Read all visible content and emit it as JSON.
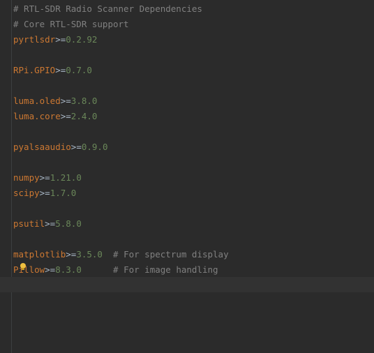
{
  "editor": {
    "lines": [
      {
        "comment": "# RTL-SDR Radio Scanner Dependencies"
      },
      {
        "comment": "# Core RTL-SDR support"
      },
      {
        "pkg": "pyrtlsdr",
        "op": ">=",
        "ver": "0.2.92"
      },
      {},
      {
        "pkg": "RPi.GPIO",
        "op": ">=",
        "ver": "0.7.0"
      },
      {},
      {
        "pkg": "luma.oled",
        "op": ">=",
        "ver": "3.8.0"
      },
      {
        "pkg": "luma.core",
        "op": ">=",
        "ver": "2.4.0"
      },
      {},
      {
        "pkg": "pyalsaaudio",
        "op": ">=",
        "ver": "0.9.0"
      },
      {},
      {
        "pkg": "numpy",
        "op": ">=",
        "ver": "1.21.0"
      },
      {
        "pkg": "scipy",
        "op": ">=",
        "ver": "1.7.0"
      },
      {},
      {
        "pkg": "psutil",
        "op": ">=",
        "ver": "5.8.0"
      },
      {},
      {
        "pkg": "matplotlib",
        "op": ">=",
        "ver": "3.5.0",
        "pad": "  ",
        "comment": "# For spectrum display"
      },
      {
        "pkg": "Pillow",
        "op": ">=",
        "ver": "8.3.0",
        "pad": "      ",
        "comment": "# For image handling"
      },
      {}
    ],
    "intention_icon": "lightbulb-icon",
    "colors": {
      "background": "#2b2b2b",
      "package": "#cc7832",
      "operator": "#a9b7c6",
      "version": "#6a8759",
      "comment": "#808080",
      "current_line": "#323232"
    }
  }
}
